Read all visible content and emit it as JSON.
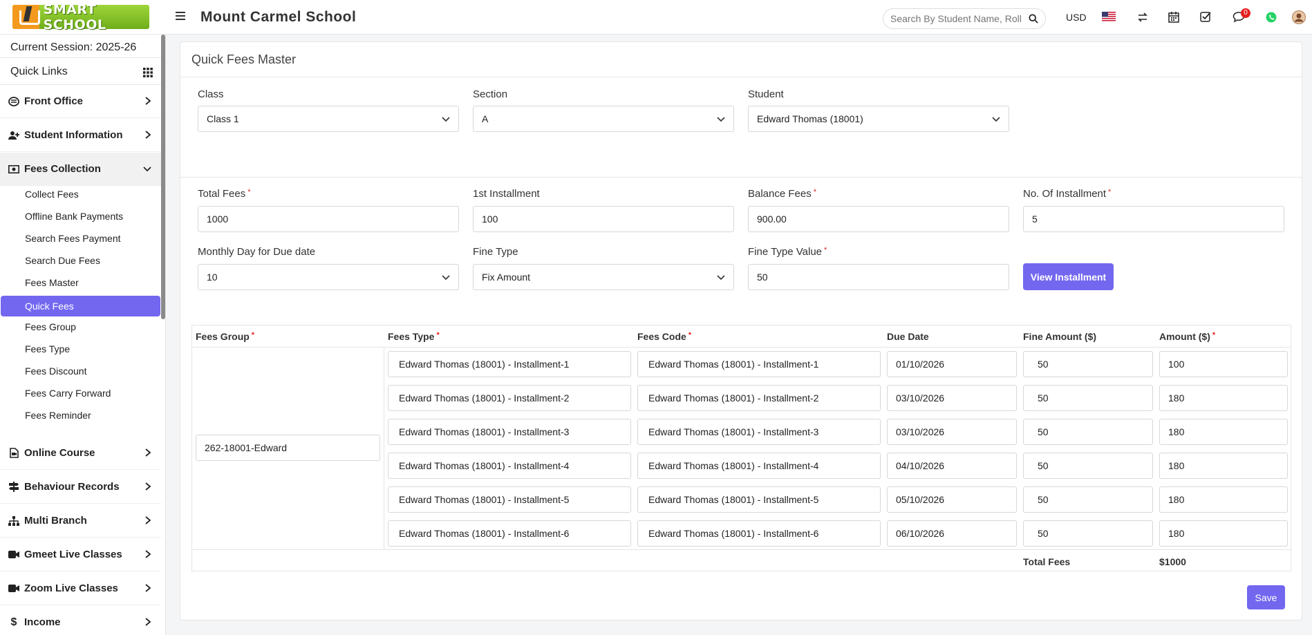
{
  "header": {
    "logo_text": "SMART SCHOOL",
    "school_name": "Mount Carmel School",
    "search_placeholder": "Search By Student Name, Roll Number, Enroll Number",
    "currency": "USD",
    "notification_count": "0"
  },
  "sidebar": {
    "session": "Current Session: 2025-26",
    "quick_links": "Quick Links",
    "menu": {
      "front_office": "Front Office",
      "student_information": "Student Information",
      "fees_collection": "Fees Collection",
      "online_course": "Online Course",
      "behaviour_records": "Behaviour Records",
      "multi_branch": "Multi Branch",
      "gmeet_live_classes": "Gmeet Live Classes",
      "zoom_live_classes": "Zoom Live Classes",
      "income": "Income"
    },
    "fees_sub": [
      "Collect Fees",
      "Offline Bank Payments",
      "Search Fees Payment",
      "Search Due Fees",
      "Fees Master",
      "Quick Fees",
      "Fees Group",
      "Fees Type",
      "Fees Discount",
      "Fees Carry Forward",
      "Fees Reminder"
    ]
  },
  "page": {
    "title": "Quick Fees Master",
    "class_label": "Class",
    "class_value": "Class 1",
    "section_label": "Section",
    "section_value": "A",
    "student_label": "Student",
    "student_value": "Edward Thomas (18001)",
    "total_fees_label": "Total Fees",
    "total_fees_value": "1000",
    "first_installment_label": "1st Installment",
    "first_installment_value": "100",
    "balance_fees_label": "Balance Fees",
    "balance_fees_value": "900.00",
    "no_installment_label": "No. Of Installment",
    "no_installment_value": "5",
    "monthly_day_label": "Monthly Day for Due date",
    "monthly_day_value": "10",
    "fine_type_label": "Fine Type",
    "fine_type_value": "Fix Amount",
    "fine_type_value_label": "Fine Type Value",
    "fine_type_value_value": "50",
    "view_installment_button": "View Installment",
    "save_button": "Save",
    "required_mark": "*"
  },
  "table": {
    "headers": {
      "fees_group": "Fees Group",
      "fees_type": "Fees Type",
      "fees_code": "Fees Code",
      "due_date": "Due Date",
      "fine_amount": "Fine Amount ($)",
      "amount": "Amount ($)"
    },
    "fees_group_value": "262-18001-Edward",
    "rows": [
      {
        "fees_type": "Edward  Thomas (18001) - Installment-1",
        "fees_code": "Edward  Thomas (18001) - Installment-1",
        "due_date": "01/10/2026",
        "fine_amount": "50",
        "amount": "100"
      },
      {
        "fees_type": "Edward  Thomas (18001) - Installment-2",
        "fees_code": "Edward  Thomas (18001) - Installment-2",
        "due_date": "03/10/2026",
        "fine_amount": "50",
        "amount": "180"
      },
      {
        "fees_type": "Edward  Thomas (18001) - Installment-3",
        "fees_code": "Edward  Thomas (18001) - Installment-3",
        "due_date": "03/10/2026",
        "fine_amount": "50",
        "amount": "180"
      },
      {
        "fees_type": "Edward  Thomas (18001) - Installment-4",
        "fees_code": "Edward  Thomas (18001) - Installment-4",
        "due_date": "04/10/2026",
        "fine_amount": "50",
        "amount": "180"
      },
      {
        "fees_type": "Edward  Thomas (18001) - Installment-5",
        "fees_code": "Edward  Thomas (18001) - Installment-5",
        "due_date": "05/10/2026",
        "fine_amount": "50",
        "amount": "180"
      },
      {
        "fees_type": "Edward  Thomas (18001) - Installment-6",
        "fees_code": "Edward  Thomas (18001) - Installment-6",
        "due_date": "06/10/2026",
        "fine_amount": "50",
        "amount": "180"
      }
    ],
    "total_label": "Total Fees",
    "total_value": "$1000"
  },
  "colors": {
    "accent": "#7367f0",
    "required": "#e52020",
    "logo_green": "#7cbf22",
    "logo_orange": "#f39a1e"
  }
}
